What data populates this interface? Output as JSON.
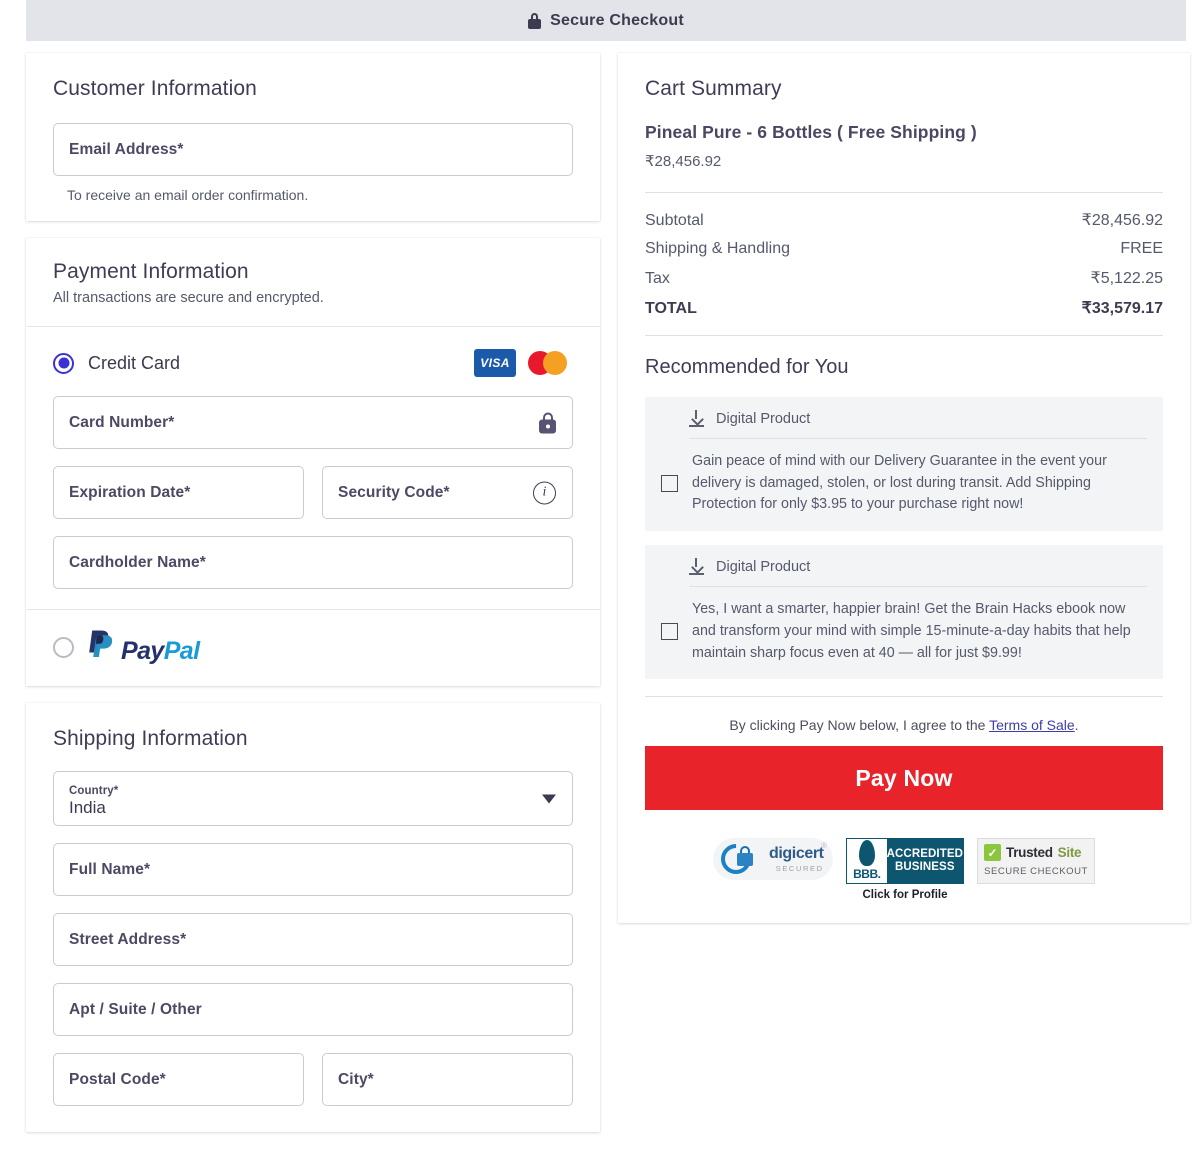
{
  "header": {
    "title": "Secure Checkout",
    "lock_icon": "lock-icon"
  },
  "customer": {
    "title": "Customer Information",
    "email_placeholder": "Email Address*",
    "email_value": "",
    "help": "To receive an email order confirmation."
  },
  "payment": {
    "title": "Payment Information",
    "subtitle": "All transactions are secure and encrypted.",
    "methods": [
      {
        "id": "credit-card",
        "label": "Credit Card",
        "selected": true
      },
      {
        "id": "paypal",
        "label": "PayPal",
        "selected": false
      }
    ],
    "brands": [
      {
        "name": "visa-logo",
        "text": "VISA"
      },
      {
        "name": "mastercard-logo",
        "text": ""
      }
    ],
    "fields": {
      "card_number": "Card Number*",
      "expiration": "Expiration Date*",
      "security_code": "Security Code*",
      "cardholder": "Cardholder Name*"
    },
    "paypal_word_1": "Pay",
    "paypal_word_2": "Pal"
  },
  "shipping": {
    "title": "Shipping Information",
    "country_label": "Country*",
    "country_value": "India",
    "fields": {
      "full_name": "Full Name*",
      "street": "Street Address*",
      "apt": "Apt / Suite / Other",
      "postal": "Postal Code*",
      "city": "City*"
    }
  },
  "cart": {
    "title": "Cart Summary",
    "product_name": "Pineal Pure - 6 Bottles ( Free Shipping )",
    "product_price": "₹28,456.92",
    "lines": [
      {
        "label": "Subtotal",
        "value": "₹28,456.92"
      },
      {
        "label": "Shipping & Handling",
        "value": "FREE"
      },
      {
        "label": "Tax",
        "value": "₹5,122.25"
      }
    ],
    "total_label": "TOTAL",
    "total_value": "₹33,579.17"
  },
  "recommended": {
    "title": "Recommended for You",
    "items": [
      {
        "tag": "Digital Product",
        "description": "Gain peace of mind with our Delivery Guarantee in the event your delivery is damaged, stolen, or lost during transit. Add Shipping Protection for only $3.95 to your purchase right now!",
        "checked": false
      },
      {
        "tag": "Digital Product",
        "description": "Yes, I want a smarter, happier brain! Get the Brain Hacks ebook now and transform your mind with simple 15-minute-a-day habits that help maintain sharp focus even at 40 — all for just $9.99!",
        "checked": false
      }
    ]
  },
  "checkout": {
    "terms_prefix": "By clicking Pay Now below, I agree to the ",
    "terms_link": "Terms of Sale",
    "terms_suffix": ".",
    "pay_button": "Pay Now",
    "accent_color": "#e8232a"
  },
  "badges": {
    "digicert": {
      "name": "digicert",
      "sub": "SECURED",
      "reg": "®"
    },
    "bbb": {
      "name": "BBB.",
      "line1": "ACCREDITED",
      "line2": "BUSINESS",
      "caption": "Click for Profile"
    },
    "trustedsite": {
      "name1": "Trusted",
      "name2": "Site",
      "sub": "SECURE CHECKOUT"
    }
  }
}
